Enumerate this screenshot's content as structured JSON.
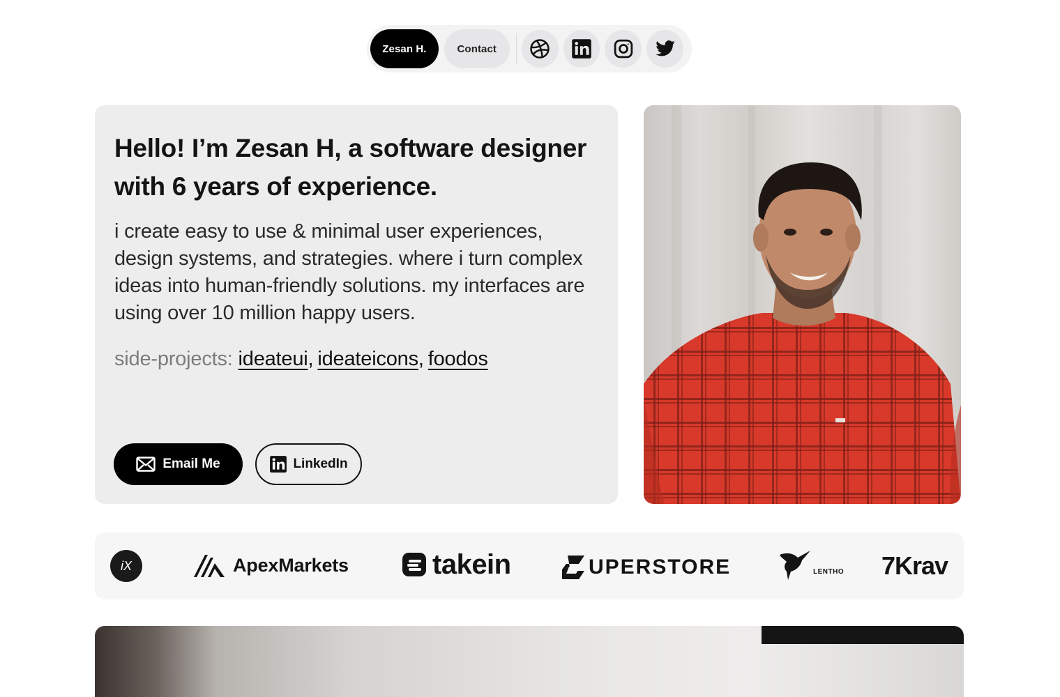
{
  "nav": {
    "name_label": "Zesan H.",
    "contact_label": "Contact",
    "social_icons": [
      "dribbble-icon",
      "linkedin-icon",
      "instagram-icon",
      "twitter-icon"
    ]
  },
  "hero": {
    "title": "Hello! I’m Zesan H, a software designer with 6 years of experience.",
    "description": "i create easy to use & minimal user experiences, design systems, and strategies. where i turn complex ideas into human-friendly solutions. my interfaces are using over 10 million happy users.",
    "side_projects_label": "side-projects:",
    "side_projects": [
      "ideateui",
      "ideateicons",
      "foodos"
    ],
    "separator": ",",
    "email_button": "Email Me",
    "linkedin_button": "LinkedIn"
  },
  "logos": {
    "items": [
      "iX",
      "ApexMarkets",
      "takein",
      "UPERSTORE",
      "LENTHO",
      "7Krav"
    ]
  },
  "colors": {
    "accent": "#000000",
    "card_bg": "#ededee",
    "nav_bg": "#f3f3f4",
    "shirt_red": "#d83a2a"
  }
}
